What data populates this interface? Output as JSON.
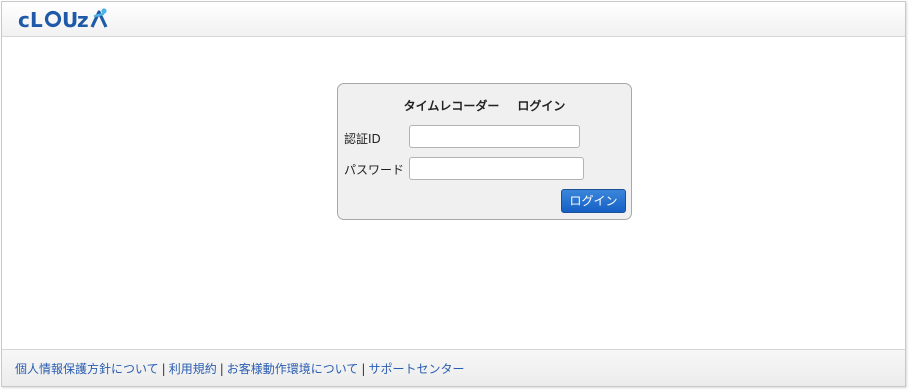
{
  "header": {
    "logo_text": "cLOUZA",
    "brand_color": "#1e5aa8"
  },
  "login": {
    "title_left": "タイムレコーダー",
    "title_right": "ログイン",
    "id_label": "認証ID",
    "id_value": "",
    "password_label": "パスワード",
    "password_value": "",
    "submit_label": "ログイン",
    "button_color": "#1560c4"
  },
  "footer": {
    "links": [
      "個人情報保護方針について",
      "利用規約",
      "お客様動作環境について",
      "サポートセンター"
    ],
    "separator": "|",
    "link_color": "#2a5db0"
  }
}
